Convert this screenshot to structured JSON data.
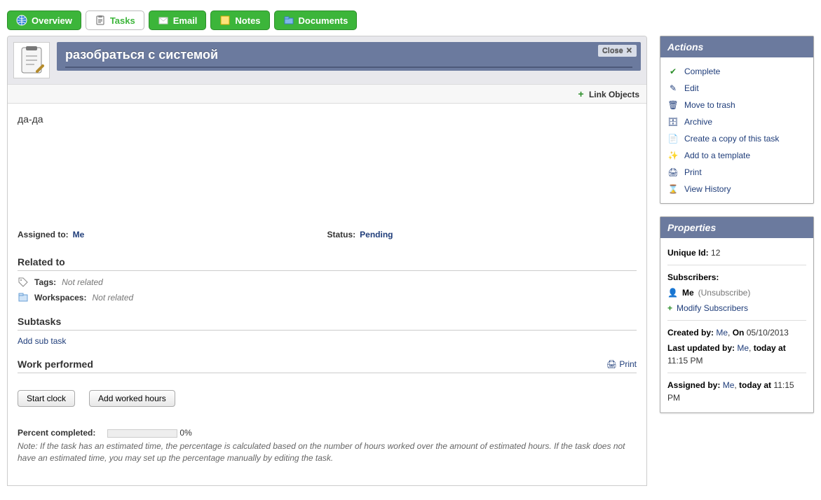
{
  "tabs": {
    "overview": "Overview",
    "tasks": "Tasks",
    "email": "Email",
    "notes": "Notes",
    "documents": "Documents"
  },
  "header": {
    "title": "разобраться с системой",
    "close": "Close",
    "link_objects": "Link Objects"
  },
  "desc": "да-да",
  "assigned": {
    "label": "Assigned to:",
    "value": "Me"
  },
  "status": {
    "label": "Status:",
    "value": "Pending"
  },
  "related": {
    "heading": "Related to",
    "tags_label": "Tags:",
    "tags_value": "Not related",
    "ws_label": "Workspaces:",
    "ws_value": "Not related"
  },
  "subtasks": {
    "heading": "Subtasks",
    "add": "Add sub task"
  },
  "work": {
    "heading": "Work performed",
    "print": "Print",
    "start_clock": "Start clock",
    "add_hours": "Add worked hours",
    "percent_label": "Percent completed:",
    "percent_value": "0%",
    "note": "Note: If the task has an estimated time, the percentage is calculated based on the number of hours worked over the amount of estimated hours. If the task does not have an estimated time, you may set up the percentage manually by editing the task."
  },
  "actions": {
    "heading": "Actions",
    "complete": "Complete",
    "edit": "Edit",
    "trash": "Move to trash",
    "archive": "Archive",
    "copy": "Create a copy of this task",
    "template": "Add to a template",
    "print": "Print",
    "history": "View History"
  },
  "properties": {
    "heading": "Properties",
    "uid_label": "Unique Id:",
    "uid_value": "12",
    "subs_label": "Subscribers:",
    "subs_me": "Me",
    "subs_unsub": "(Unsubscribe)",
    "modify_subs": "Modify Subscribers",
    "created_by_label": "Created by:",
    "created_by_value": "Me",
    "on_label": "On",
    "created_on": "05/10/2013",
    "updated_by_label": "Last updated by:",
    "updated_by_value": "Me",
    "updated_time_prefix": "today at",
    "updated_time": "11:15 PM",
    "assigned_by_label": "Assigned by:",
    "assigned_by_value": "Me",
    "assigned_time_prefix": "today at",
    "assigned_time": "11:15 PM"
  }
}
